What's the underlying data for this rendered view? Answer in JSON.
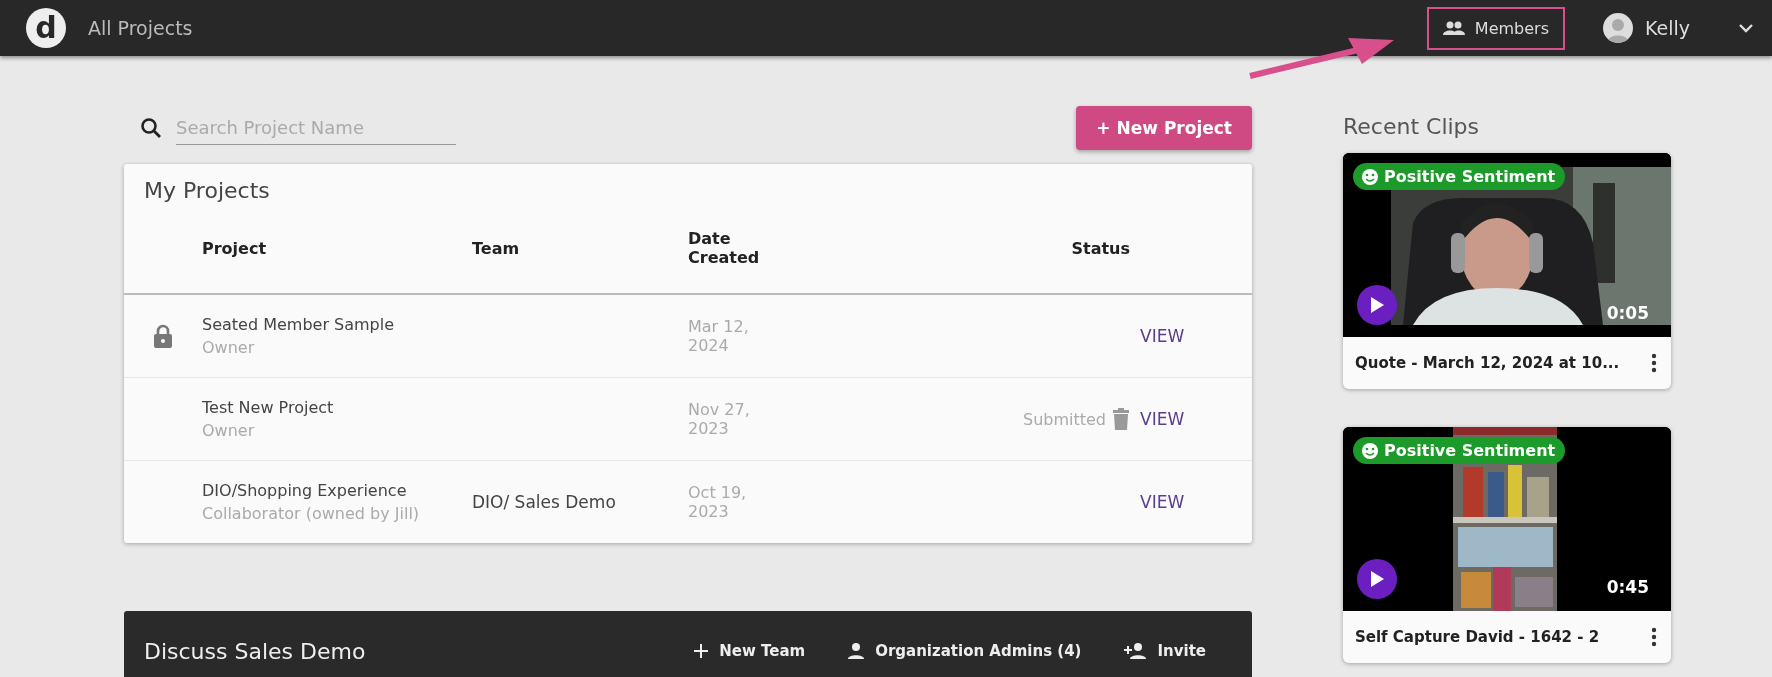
{
  "top_bar": {
    "logo": "d",
    "title": "All Projects",
    "members_button": {
      "label": "Members",
      "highlighted": true
    },
    "user": {
      "name": "Kelly"
    }
  },
  "search": {
    "placeholder": "Search Project Name"
  },
  "new_project_button": "+ New Project",
  "projects": {
    "title": "My Projects",
    "columns": [
      "Project",
      "Team",
      "Date\nCreated",
      "Status"
    ],
    "rows": [
      {
        "name": "Seated Member Sample",
        "role": "Owner",
        "team": "",
        "date": "Mar 12,\n2024",
        "status": "",
        "locked": true,
        "action": "VIEW"
      },
      {
        "name": "Test New Project",
        "role": "Owner",
        "team": "",
        "date": "Nov 27,\n2023",
        "status": "Submitted",
        "locked": false,
        "action": "VIEW"
      },
      {
        "name": "DIO/Shopping Experience",
        "role": "Collaborator (owned by Jill)",
        "team": "DIO/ Sales Demo",
        "date": "Oct 19,\n2023",
        "status": "",
        "locked": false,
        "action": "VIEW"
      }
    ]
  },
  "team_bar": {
    "title": "Discuss Sales Demo",
    "actions": [
      {
        "kind": "add",
        "label": "New Team"
      },
      {
        "kind": "person",
        "label": "Organization Admins (4)"
      },
      {
        "kind": "invite",
        "label": "Invite"
      }
    ]
  },
  "recent_clips": {
    "title": "Recent Clips",
    "clips": [
      {
        "badge": "Positive Sentiment",
        "duration": "0:05",
        "title": "Quote - March 12, 2024 at 10..."
      },
      {
        "badge": "Positive Sentiment",
        "duration": "0:45",
        "title": "Self Capture David - 1642 - 2"
      }
    ]
  }
}
